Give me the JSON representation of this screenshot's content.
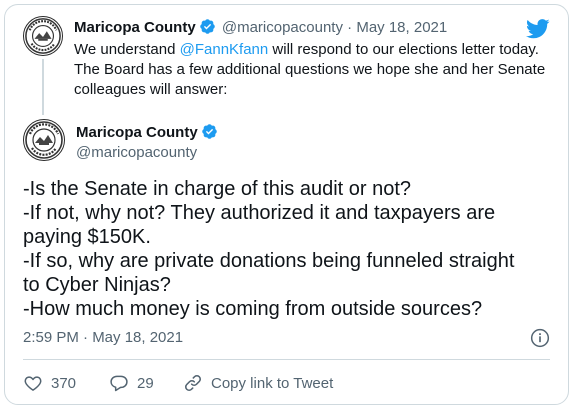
{
  "quoted_tweet": {
    "name": "Maricopa County",
    "handle": "@maricopacounty",
    "separator": "·",
    "date": "May 18, 2021",
    "text_before": "We understand ",
    "mention": "@FannKfann",
    "text_after": " will respond to our elections letter today. The Board has a few additional questions we hope she and her Senate colleagues will answer:"
  },
  "main_tweet": {
    "name": "Maricopa County",
    "handle": "@maricopacounty",
    "lines": [
      "-Is the Senate in charge of this audit or not?",
      "-If not, why not? They authorized it and taxpayers are",
      "paying $150K.",
      "-If so, why are private donations being funneled straight",
      "to Cyber Ninjas?",
      "-How much money is coming from outside sources?"
    ],
    "timestamp": "2:59 PM · May 18, 2021"
  },
  "actions": {
    "likes": "370",
    "replies": "29",
    "copy_link_label": "Copy link to Tweet"
  },
  "icons": {
    "verified": "verified-badge-icon",
    "brand": "twitter-bird-icon",
    "info": "info-icon",
    "like": "heart-icon",
    "reply": "reply-bubble-icon",
    "link": "link-icon"
  },
  "colors": {
    "brand_blue": "#1d9bf0",
    "text": "#0f1419",
    "muted": "#536471",
    "border": "#cfd9de"
  }
}
